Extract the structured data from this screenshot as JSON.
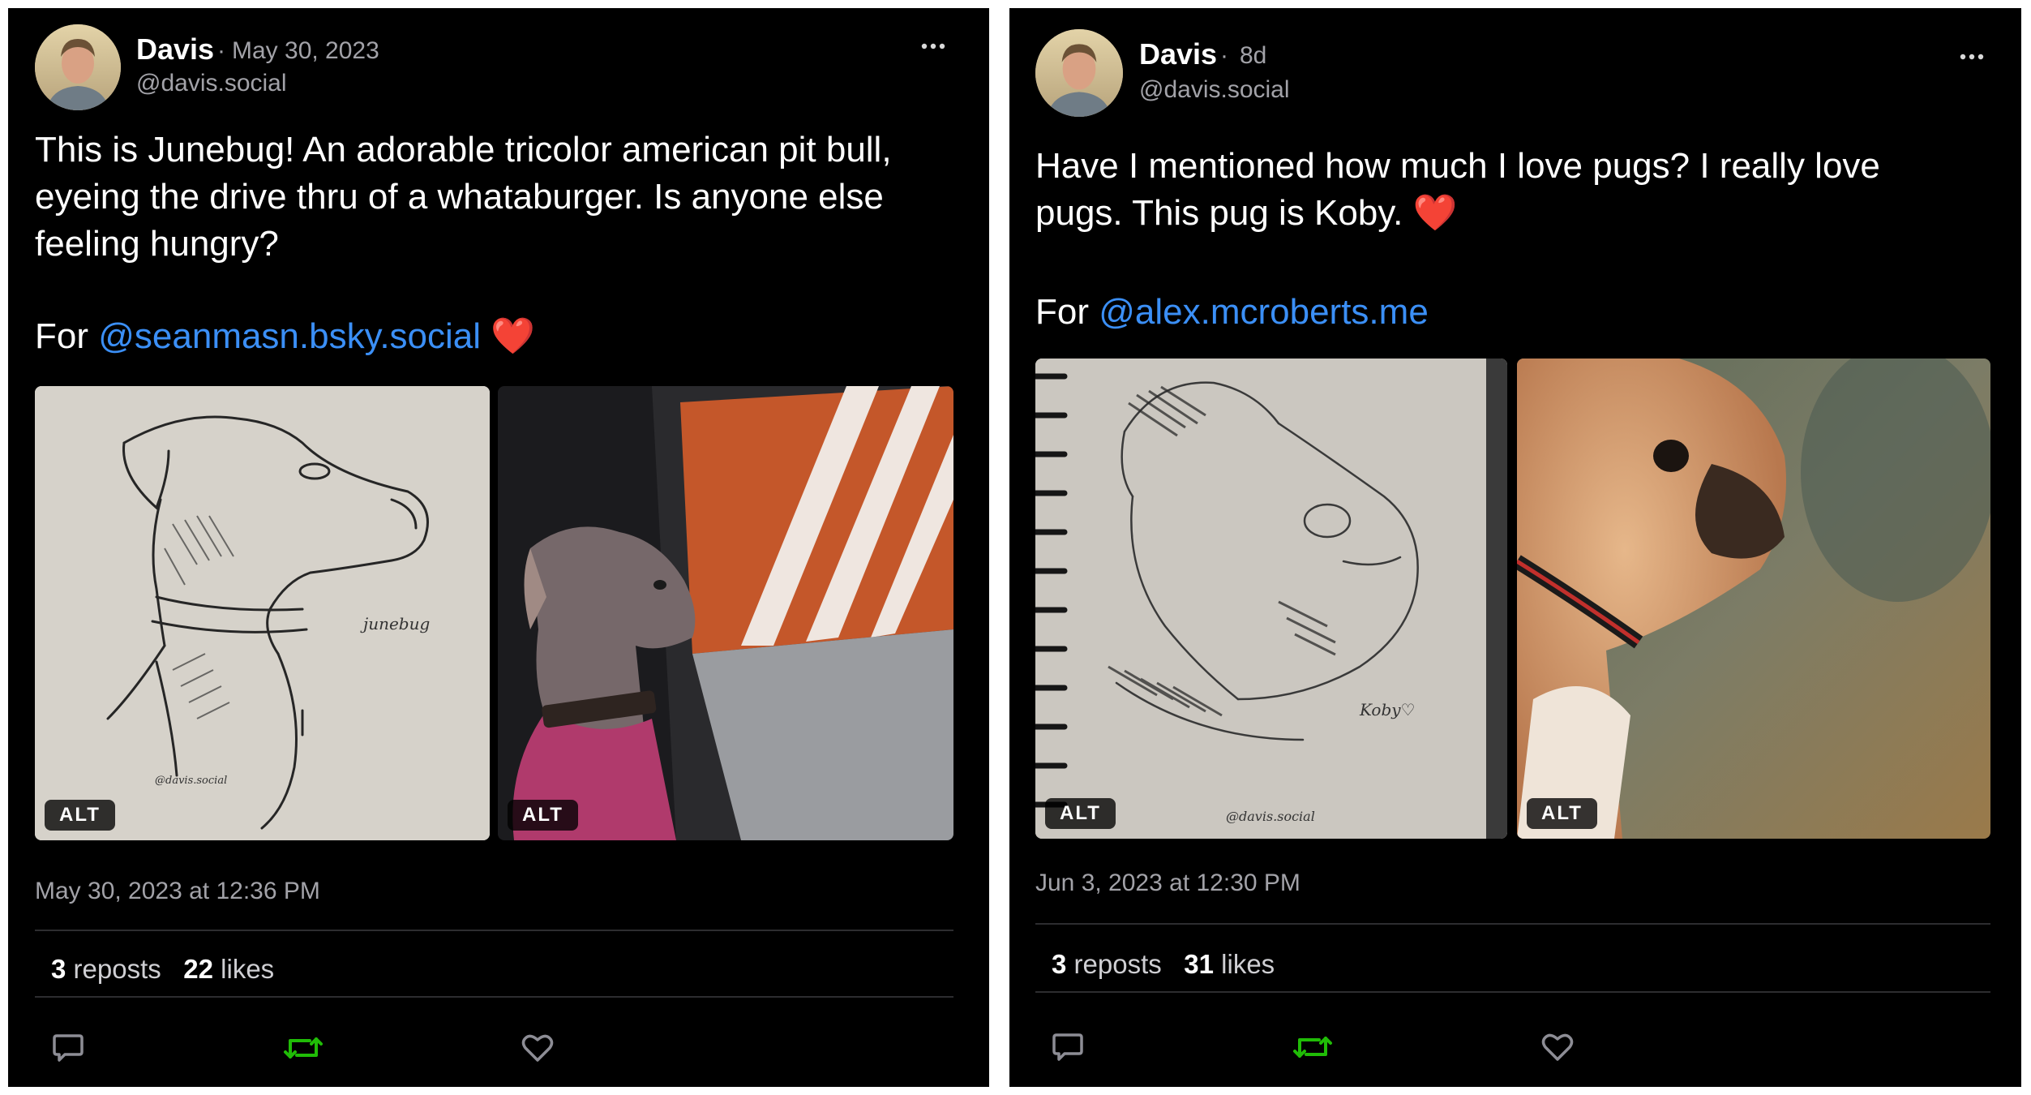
{
  "posts": [
    {
      "author_name": "Davis",
      "separator": "·",
      "date_short": "May 30, 2023",
      "handle": "@davis.social",
      "more_label": "•••",
      "text_lines": [
        "This is Junebug! An adorable tricolor american pit bull,",
        "eyeing the drive thru of a whataburger. Is anyone else",
        "feeling hungry?"
      ],
      "for_label": "For",
      "mention": "@seanmasn.bsky.social",
      "heart": "❤️",
      "images": [
        {
          "description": "pencil sketch of pit bull",
          "alt_label": "ALT",
          "sketch_caption": "junebug",
          "signature": "@davis.social"
        },
        {
          "description": "pit bull in car window",
          "alt_label": "ALT"
        }
      ],
      "timestamp": "May 30, 2023 at 12:36 PM",
      "reposts_count": "3",
      "reposts_label": "reposts",
      "likes_count": "22",
      "likes_label": "likes"
    },
    {
      "author_name": "Davis",
      "separator": "·",
      "date_short": "8d",
      "handle": "@davis.social",
      "more_label": "•••",
      "text_lines": [
        "Have I mentioned how much I love pugs? I really love",
        "pugs. This pug is Koby."
      ],
      "for_label": "For",
      "mention": "@alex.mcroberts.me",
      "heart": "❤️",
      "images": [
        {
          "description": "pencil sketch of pug",
          "alt_label": "ALT",
          "sketch_caption": "Koby♡",
          "signature": "@davis.social"
        },
        {
          "description": "pug photo in sunlight",
          "alt_label": "ALT"
        }
      ],
      "timestamp": "Jun 3, 2023 at 12:30 PM",
      "reposts_count": "3",
      "reposts_label": "reposts",
      "likes_count": "31",
      "likes_label": "likes"
    }
  ],
  "icons": {
    "reply": "comment-bubble-icon",
    "repost": "repost-arrows-icon",
    "like": "heart-outline-icon",
    "more": "ellipsis-icon"
  },
  "colors": {
    "background": "#000000",
    "mention": "#3b8ff6",
    "repost_active": "#20bc07",
    "muted": "#a2a2a8"
  }
}
